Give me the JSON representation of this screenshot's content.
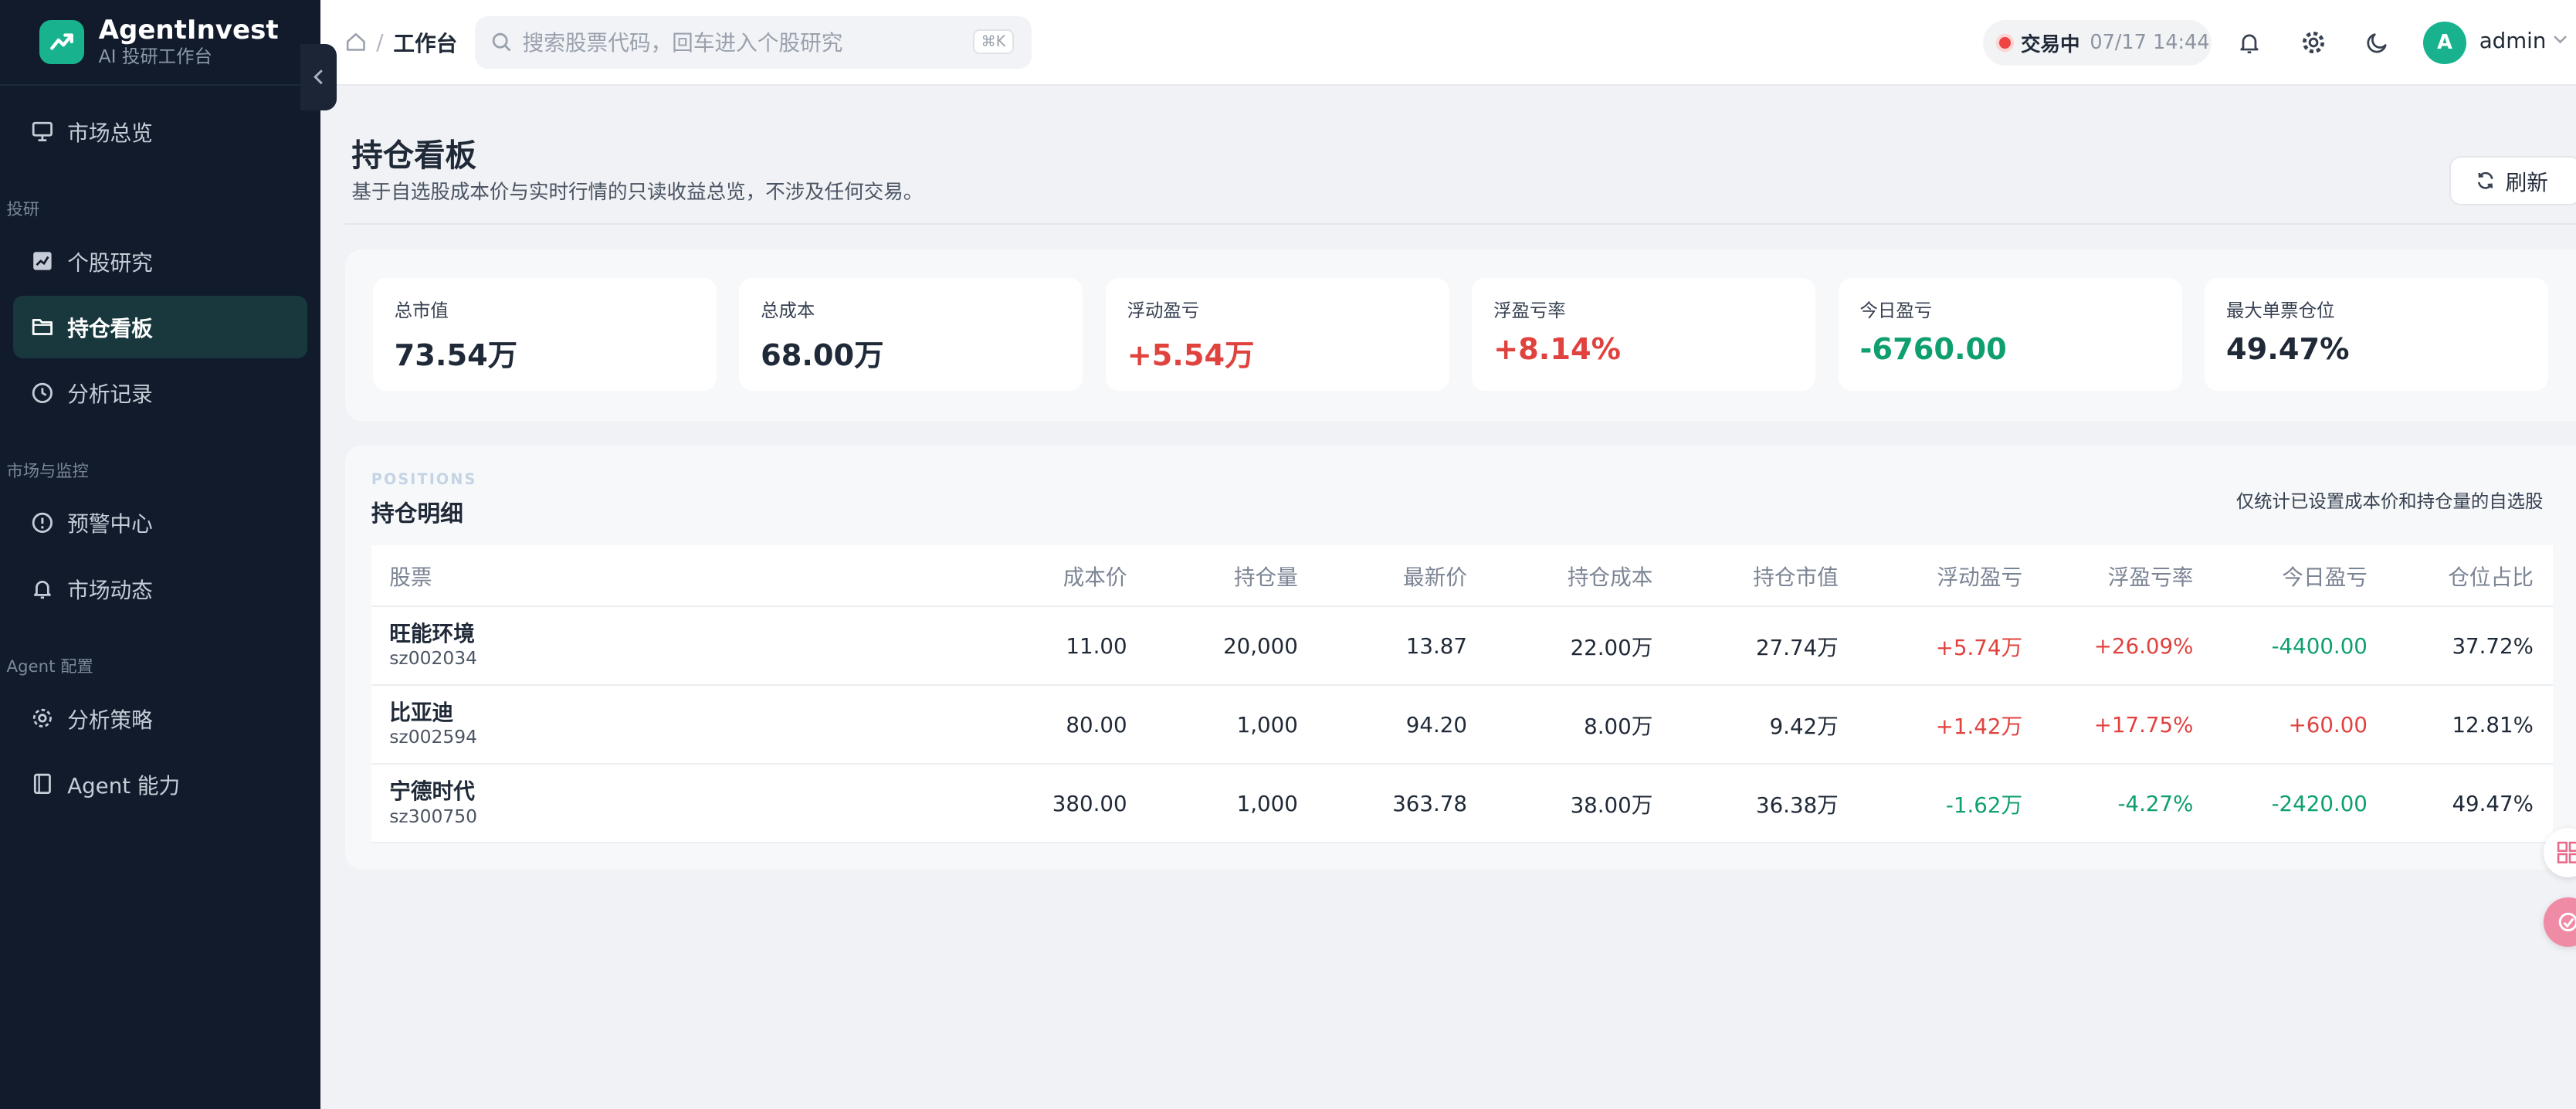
{
  "brand": {
    "name": "AgentInvest",
    "subtitle": "AI 投研工作台"
  },
  "sidebar": {
    "items": [
      {
        "label": "市场总览"
      },
      {
        "group": "投研"
      },
      {
        "label": "个股研究"
      },
      {
        "label": "持仓看板",
        "active": true
      },
      {
        "label": "分析记录"
      },
      {
        "group": "市场与监控"
      },
      {
        "label": "预警中心"
      },
      {
        "label": "市场动态"
      },
      {
        "group": "Agent 配置"
      },
      {
        "label": "分析策略"
      },
      {
        "label": "Agent 能力"
      }
    ]
  },
  "topbar": {
    "breadcrumb_current": "工作台",
    "breadcrumb_separator": "/",
    "search_placeholder": "搜索股票代码，回车进入个股研究",
    "search_shortcut": "⌘K",
    "market_status": "交易中",
    "market_time": "07/17 14:44",
    "avatar_initial": "A",
    "username": "admin"
  },
  "page": {
    "title": "持仓看板",
    "description": "基于自选股成本价与实时行情的只读收益总览，不涉及任何交易。",
    "refresh_label": "刷新"
  },
  "stats": [
    {
      "label": "总市值",
      "value": "73.54万",
      "tone": "neutral"
    },
    {
      "label": "总成本",
      "value": "68.00万",
      "tone": "neutral"
    },
    {
      "label": "浮动盈亏",
      "value": "+5.54万",
      "tone": "pos"
    },
    {
      "label": "浮盈亏率",
      "value": "+8.14%",
      "tone": "pos"
    },
    {
      "label": "今日盈亏",
      "value": "-6760.00",
      "tone": "neg"
    },
    {
      "label": "最大单票仓位",
      "value": "49.47%",
      "tone": "neutral"
    }
  ],
  "positions": {
    "eyebrow": "POSITIONS",
    "title": "持仓明细",
    "note": "仅统计已设置成本价和持仓量的自选股",
    "columns": [
      "股票",
      "成本价",
      "持仓量",
      "最新价",
      "持仓成本",
      "持仓市值",
      "浮动盈亏",
      "浮盈亏率",
      "今日盈亏",
      "仓位占比"
    ],
    "rows": [
      {
        "name": "旺能环境",
        "code": "sz002034",
        "cost_price": "11.00",
        "quantity": "20,000",
        "last_price": "13.87",
        "cost_total": "22.00万",
        "market_value": "27.74万",
        "float_pnl": "+5.74万",
        "float_pnl_tone": "pos",
        "float_rate": "+26.09%",
        "float_rate_tone": "pos",
        "today_pnl": "-4400.00",
        "today_pnl_tone": "neg",
        "weight": "37.72%"
      },
      {
        "name": "比亚迪",
        "code": "sz002594",
        "cost_price": "80.00",
        "quantity": "1,000",
        "last_price": "94.20",
        "cost_total": "8.00万",
        "market_value": "9.42万",
        "float_pnl": "+1.42万",
        "float_pnl_tone": "pos",
        "float_rate": "+17.75%",
        "float_rate_tone": "pos",
        "today_pnl": "+60.00",
        "today_pnl_tone": "pos",
        "weight": "12.81%"
      },
      {
        "name": "宁德时代",
        "code": "sz300750",
        "cost_price": "380.00",
        "quantity": "1,000",
        "last_price": "363.78",
        "cost_total": "38.00万",
        "market_value": "36.38万",
        "float_pnl": "-1.62万",
        "float_pnl_tone": "neg",
        "float_rate": "-4.27%",
        "float_rate_tone": "neg",
        "today_pnl": "-2420.00",
        "today_pnl_tone": "neg",
        "weight": "49.47%"
      }
    ]
  },
  "colors": {
    "accent": "#18b38e",
    "sidebar_bg": "#111b2c",
    "gain": "#e0423e",
    "loss": "#0e9f6e"
  }
}
